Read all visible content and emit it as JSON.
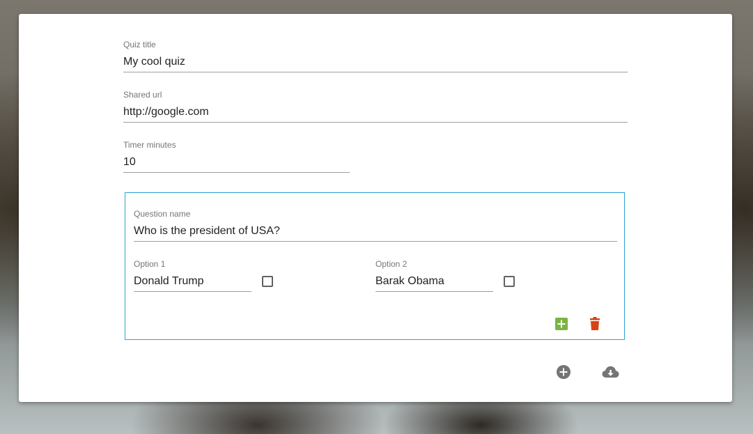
{
  "quiz": {
    "title_label": "Quiz title",
    "title_value": "My cool quiz",
    "url_label": "Shared url",
    "url_value": "http://google.com",
    "timer_label": "Timer minutes",
    "timer_value": "10"
  },
  "question": {
    "name_label": "Question name",
    "name_value": "Who is the president of USA?",
    "options": [
      {
        "label": "Option 1",
        "value": "Donald Trump",
        "checked": false
      },
      {
        "label": "Option 2",
        "value": "Barak Obama",
        "checked": false
      }
    ],
    "actions": {
      "add_option_icon": "plus-box-icon",
      "delete_icon": "trash-icon"
    }
  },
  "footer": {
    "add_question_icon": "plus-circle-icon",
    "save_icon": "cloud-download-icon"
  },
  "colors": {
    "accent_border": "#29a3d6",
    "add_green": "#7cb342",
    "delete_red": "#d84315",
    "icon_grey": "#757575"
  }
}
